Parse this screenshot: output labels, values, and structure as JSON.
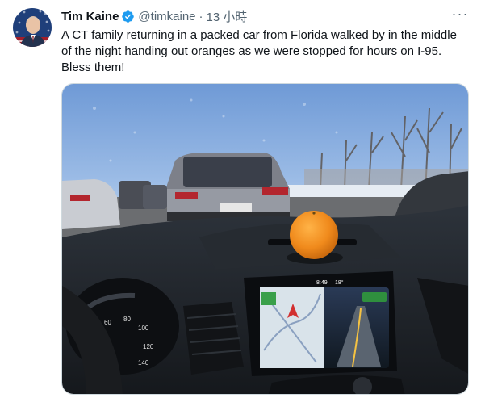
{
  "author": {
    "name": "Tim Kaine",
    "handle": "@timkaine",
    "timestamp": "13 小時",
    "verified_icon": "verified-badge-icon",
    "verified_color": "#1d9bf0"
  },
  "tweet": {
    "text_lines": [
      "A CT family returning in a packed car from Florida walked by in the middle",
      "of the night handing out oranges as we were stopped for hours on I-95.",
      "Bless them!"
    ]
  },
  "menu": {
    "icon": "more-options-icon",
    "glyph": "···"
  },
  "photo": {
    "dash_clock": "8:49",
    "dash_temp": "18°",
    "gauge_ticks": [
      "60",
      "80",
      "100",
      "120",
      "140"
    ]
  },
  "colors": {
    "text": "#0f1419",
    "secondary": "#536471",
    "border": "#cfd9de"
  }
}
